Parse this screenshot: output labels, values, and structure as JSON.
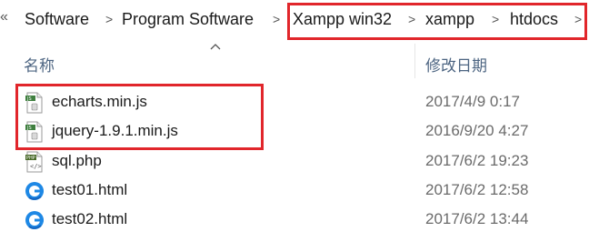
{
  "breadcrumb": {
    "back_chevron": "«",
    "items": [
      "Software",
      "Program Software",
      "Xampp win32",
      "xampp",
      "htdocs"
    ],
    "separator": ">"
  },
  "columns": {
    "name_label": "名称",
    "date_label": "修改日期"
  },
  "files": [
    {
      "name": "echarts.min.js",
      "date": "2017/4/9 0:17",
      "icon": "js-file-icon"
    },
    {
      "name": "jquery-1.9.1.min.js",
      "date": "2016/9/20 4:27",
      "icon": "js-file-icon"
    },
    {
      "name": "sql.php",
      "date": "2017/6/2 19:23",
      "icon": "php-file-icon"
    },
    {
      "name": "test01.html",
      "date": "2017/6/2 12:58",
      "icon": "html-file-icon"
    },
    {
      "name": "test02.html",
      "date": "2017/6/2 13:44",
      "icon": "html-file-icon"
    }
  ],
  "highlight_color": "#e1262b"
}
